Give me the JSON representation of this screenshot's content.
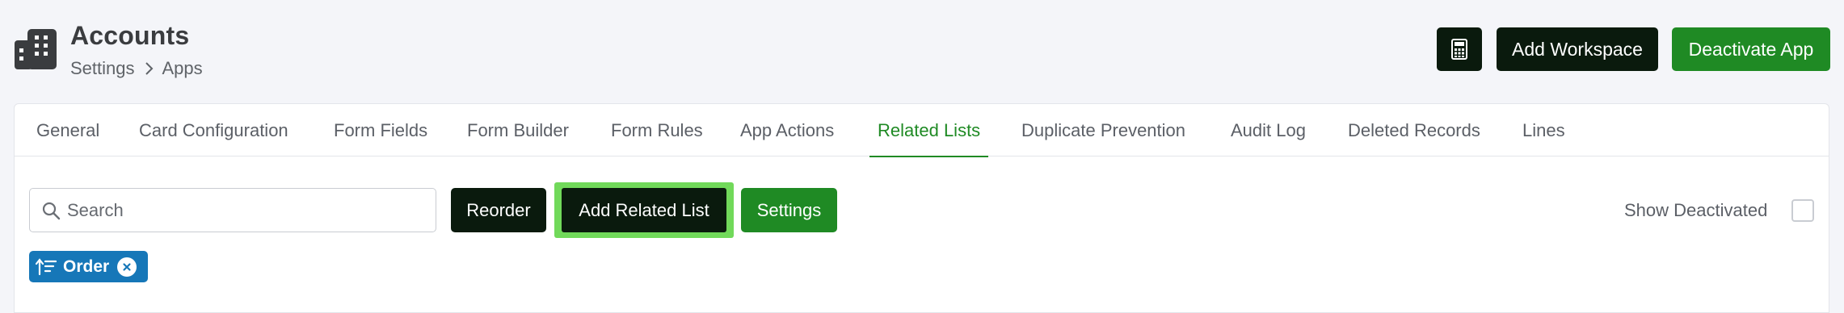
{
  "header": {
    "title": "Accounts",
    "breadcrumb": [
      "Settings",
      "Apps"
    ],
    "buttons": {
      "calculator_icon": "calculator-icon",
      "add_workspace": "Add Workspace",
      "deactivate_app": "Deactivate App"
    }
  },
  "tabs": [
    {
      "label": "General"
    },
    {
      "label": "Card Configuration"
    },
    {
      "label": "Form Fields"
    },
    {
      "label": "Form Builder"
    },
    {
      "label": "Form Rules"
    },
    {
      "label": "App Actions"
    },
    {
      "label": "Related Lists",
      "active": true
    },
    {
      "label": "Duplicate Prevention"
    },
    {
      "label": "Audit Log"
    },
    {
      "label": "Deleted Records"
    },
    {
      "label": "Lines"
    }
  ],
  "toolbar": {
    "search_placeholder": "Search",
    "search_value": "",
    "reorder": "Reorder",
    "add_related_list": "Add Related List",
    "settings": "Settings",
    "show_deactivated": "Show Deactivated",
    "show_deactivated_checked": false
  },
  "filter_chip": {
    "label": "Order",
    "icon": "sort-ascending-icon"
  },
  "colors": {
    "accent_green": "#1f8a24",
    "dark_button": "#0a1a0d",
    "highlight": "#71d95a",
    "chip_blue": "#1677b8"
  }
}
